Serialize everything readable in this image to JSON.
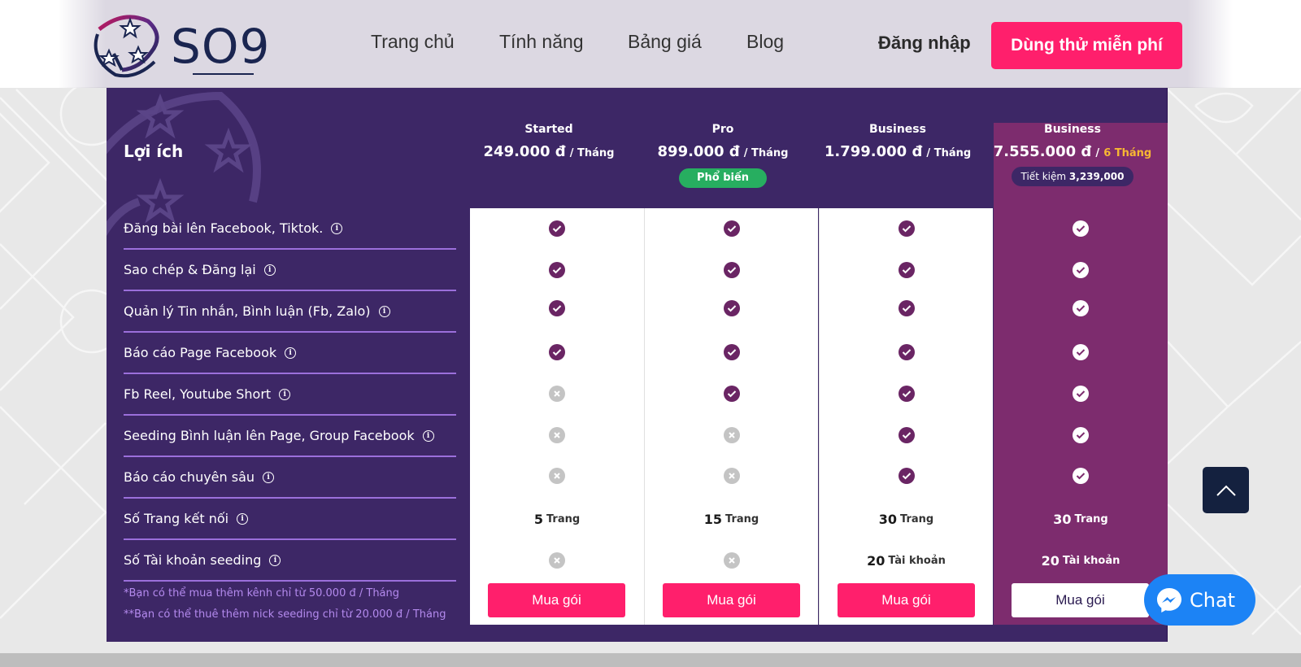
{
  "header": {
    "logo_text": "SO9",
    "nav": [
      {
        "label": "Trang chủ"
      },
      {
        "label": "Tính năng"
      },
      {
        "label": "Bảng giá"
      },
      {
        "label": "Blog"
      }
    ],
    "login_label": "Đăng nhập",
    "trial_label": "Dùng thử miễn phí"
  },
  "pricing": {
    "benefits_title": "Lợi ích",
    "features": [
      {
        "label": "Đăng bài lên Facebook, Tiktok."
      },
      {
        "label": "Sao chép & Đăng lại"
      },
      {
        "label": "Quản lý Tin nhắn, Bình luận (Fb, Zalo)"
      },
      {
        "label": "Báo cáo Page Facebook"
      },
      {
        "label": "Fb Reel, Youtube Short"
      },
      {
        "label": "Seeding Bình luận lên Page, Group Facebook"
      },
      {
        "label": "Báo cáo chuyên sâu"
      },
      {
        "label": "Số Trang kết nối"
      },
      {
        "label": "Số Tài khoản seeding"
      }
    ],
    "notes": [
      "*Bạn có thể mua thêm kênh chỉ từ 50.000 đ / Tháng",
      "**Bạn có thể thuê thêm nick seeding chỉ từ 20.000 đ / Tháng"
    ],
    "plans": [
      {
        "name": "Started",
        "price": "249.000 đ",
        "unit": "/ Tháng",
        "badge": "",
        "included": [
          true,
          true,
          true,
          true,
          false,
          false,
          false
        ],
        "pages": {
          "value": "5",
          "unit": "Trang"
        },
        "seeding": {
          "value": "",
          "unit": "",
          "included": false
        },
        "buy_label": "Mua gói"
      },
      {
        "name": "Pro",
        "price": "899.000 đ",
        "unit": "/ Tháng",
        "badge": "Phổ biến",
        "included": [
          true,
          true,
          true,
          true,
          true,
          false,
          false
        ],
        "pages": {
          "value": "15",
          "unit": "Trang"
        },
        "seeding": {
          "value": "",
          "unit": "",
          "included": false
        },
        "buy_label": "Mua gói"
      },
      {
        "name": "Business",
        "price": "1.799.000 đ",
        "unit": "/ Tháng",
        "badge": "",
        "included": [
          true,
          true,
          true,
          true,
          true,
          true,
          true
        ],
        "pages": {
          "value": "30",
          "unit": "Trang"
        },
        "seeding": {
          "value": "20",
          "unit": "Tài khoản",
          "included": true
        },
        "buy_label": "Mua gói"
      },
      {
        "name": "Business",
        "price": "7.555.000 đ",
        "unit_prefix": "/",
        "unit": "6 Tháng",
        "savings_label": "Tiết kiệm",
        "savings_value": "3,239,000",
        "included": [
          true,
          true,
          true,
          true,
          true,
          true,
          true
        ],
        "pages": {
          "value": "30",
          "unit": "Trang"
        },
        "seeding": {
          "value": "20",
          "unit": "Tài khoản",
          "included": true
        },
        "buy_label": "Mua gói"
      }
    ]
  },
  "floating": {
    "chat_label": "Chat"
  },
  "colors": {
    "brand_pink": "#ff1f6c",
    "panel_purple": "#3d2766",
    "featured_plum": "#7d2c6e",
    "check_purple": "#6a2564",
    "popular_green": "#27ae60",
    "messenger_blue": "#1c83f5"
  }
}
